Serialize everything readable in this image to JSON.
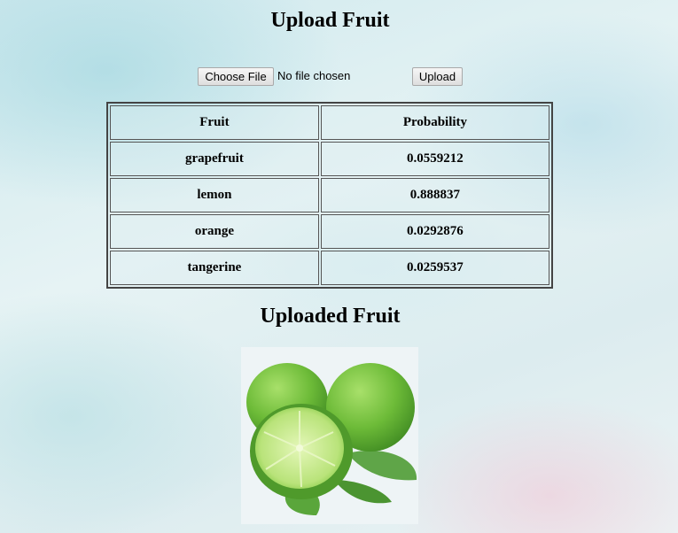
{
  "header": {
    "title": "Upload Fruit"
  },
  "upload": {
    "choose_label": "Choose File",
    "file_status": "No file chosen",
    "upload_label": "Upload"
  },
  "results": {
    "headers": [
      "Fruit",
      "Probability"
    ],
    "rows": [
      {
        "fruit": "grapefruit",
        "probability": "0.0559212"
      },
      {
        "fruit": "lemon",
        "probability": "0.888837"
      },
      {
        "fruit": "orange",
        "probability": "0.0292876"
      },
      {
        "fruit": "tangerine",
        "probability": "0.0259537"
      }
    ]
  },
  "uploaded": {
    "title": "Uploaded Fruit",
    "image_subject": "limes"
  },
  "colors": {
    "lime_dark": "#4a9a2a",
    "lime_light": "#8fd14f",
    "lime_flesh": "#c9ec8a"
  }
}
